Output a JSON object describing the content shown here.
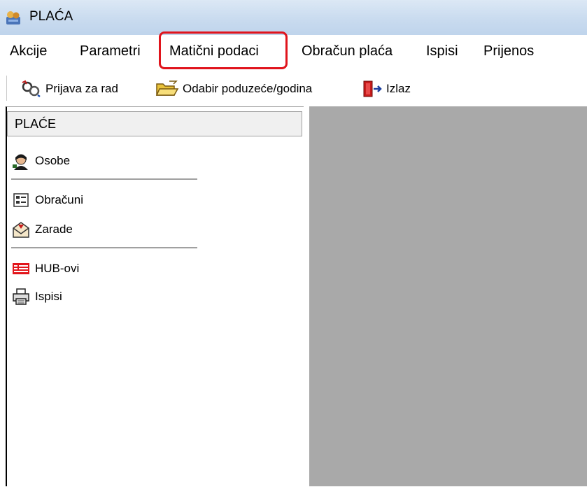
{
  "window": {
    "title": "PLAĆA"
  },
  "menu": {
    "items": [
      {
        "label": "Akcije"
      },
      {
        "label": "Parametri"
      },
      {
        "label": "Matični podaci"
      },
      {
        "label": "Obračun plaća"
      },
      {
        "label": "Ispisi"
      },
      {
        "label": "Prijenos"
      }
    ],
    "highlighted": "Matični podaci",
    "highlight_color": "#e0141c"
  },
  "toolbar": {
    "buttons": [
      {
        "label": "Prijava za rad",
        "icon": "login-keys-icon"
      },
      {
        "label": "Odabir poduzeće/godina",
        "icon": "open-folder-icon"
      },
      {
        "label": "Izlaz",
        "icon": "exit-door-icon"
      }
    ]
  },
  "panel": {
    "header": "PLAĆE",
    "items": [
      {
        "label": "Osobe",
        "icon": "person-icon"
      },
      {
        "label": "Obračuni",
        "icon": "calculation-form-icon"
      },
      {
        "label": "Zarade",
        "icon": "envelope-icon"
      },
      {
        "label": "HUB-ovi",
        "icon": "hub-form-icon"
      },
      {
        "label": "Ispisi",
        "icon": "printer-icon"
      }
    ]
  },
  "colors": {
    "workspace": "#a9a9a9",
    "titlebar": "#c9dbef"
  }
}
